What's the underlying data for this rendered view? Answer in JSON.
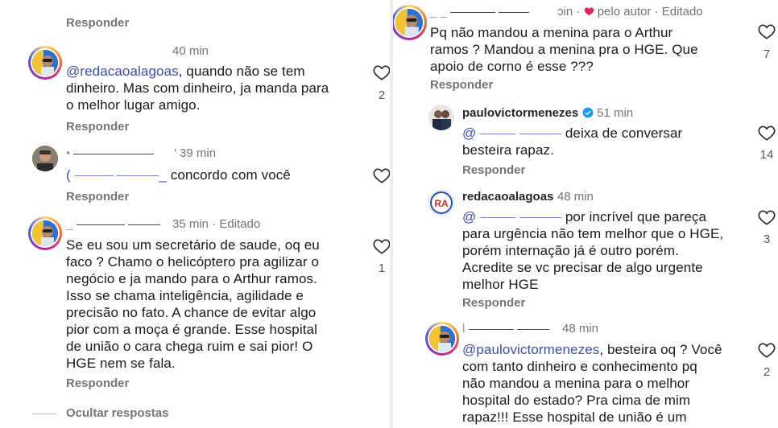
{
  "left": {
    "top_reply": "Responder",
    "c1": {
      "time": "40 min",
      "mention": "@redacaoalagoas",
      "text_after_mention": ", quando não se tem",
      "line2": "dinheiro. Mas com dinheiro, ja manda para",
      "line3": "o melhor lugar amigo.",
      "likes": "2",
      "reply": "Responder"
    },
    "c2": {
      "time": "' 39 min",
      "redacted_mention": "@ _ _ _ _____",
      "text": "concordo com você",
      "reply": "Responder"
    },
    "c3": {
      "username_redacted": "_ _ _____",
      "time": "35 min · Editado",
      "lines": [
        "Se eu sou um secretário de saude, oq eu",
        "faco ? Chamo o helicóptero pra agilizar o",
        "negócio e ja mando para o Arthur ramos.",
        "Isso se chama inteligência, agilidade e",
        "precisão no fato. A chance de evitar algo",
        "pior com a moça é grande. Esse hospital",
        "de união o cara chega ruim e sai pior! O",
        "HGE nem se fala."
      ],
      "likes": "1",
      "reply": "Responder"
    },
    "hide_replies": "Ocultar respostas"
  },
  "right": {
    "c1": {
      "header_tail": "ɔin",
      "pelo_autor": "pelo autor",
      "dot": "·",
      "edited": "Editado",
      "lines": [
        "Pq não mandou a menina para o Arthur",
        "ramos ? Mandou a menina pra o HGE. Que",
        "apoio de corno é esse ???"
      ],
      "likes": "7",
      "reply": "Responder"
    },
    "c2": {
      "username": "paulovictormenezes",
      "time": "51 min",
      "redacted_mention": "@ _ _ _ _____",
      "text_after": "deixa de conversar",
      "line2": "besteira rapaz.",
      "likes": "14",
      "reply": "Responder"
    },
    "c3": {
      "username": "redacaoalagoas",
      "time": "48 min",
      "redacted_mention": "@ _ _ _ _____",
      "text_after": "por incrível que pareça",
      "lines": [
        "para urgência não tem melhor que o HGE,",
        "porém internação já é outro porém.",
        "Acredite se vc precisar de algo urgente",
        "melhor HGE"
      ],
      "likes": "3",
      "reply": "Responder"
    },
    "c4": {
      "username_redacted": "I _ _ _____",
      "time": "48 min",
      "mention": "@paulovictormenezes",
      "text_after_mention": ", besteira oq ? Você",
      "lines": [
        "com tanto dinheiro e conhecimento pq",
        "não mandou a menina para o melhor",
        "hospital do estado? Pra cima de mim",
        "rapaz!!! Esse hospital de união é um"
      ],
      "likes": "2"
    }
  },
  "colors": {
    "mention": "#3a4fa8",
    "heart_red": "#e0245e",
    "verified": "#1d9bf0",
    "meta_gray": "#737373"
  },
  "icons": [
    "heart-icon",
    "verified-badge-icon",
    "red-heart-icon"
  ]
}
